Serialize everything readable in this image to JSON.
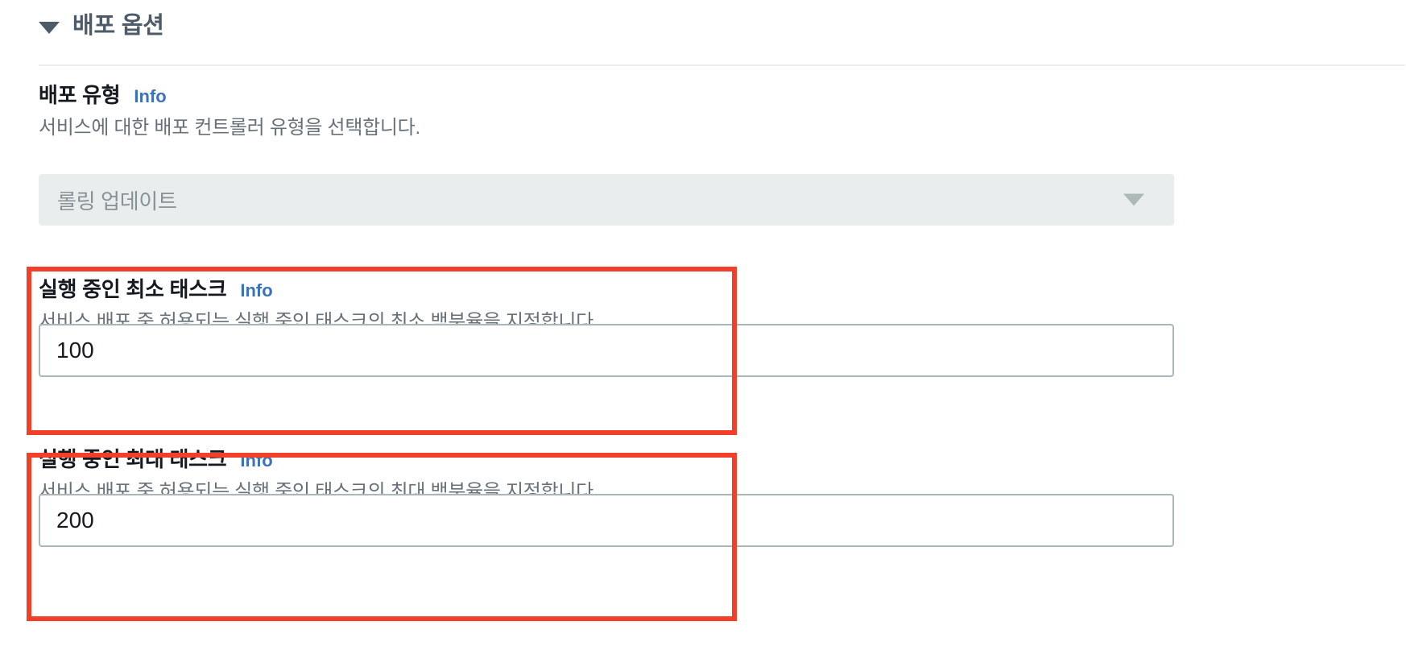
{
  "section": {
    "title": "배포 옵션",
    "caret_icon": "triangle-down-icon",
    "expanded": true
  },
  "fields": [
    {
      "key": "deployment_type",
      "label": "배포 유형",
      "info_label": "Info",
      "description": "서비스에 대한 배포 컨트롤러 유형을 선택합니다.",
      "control": "select",
      "value": "롤링 업데이트",
      "disabled": true,
      "caret_icon": "chevron-down-icon",
      "highlighted": false
    },
    {
      "key": "minimum_running_tasks",
      "label": "실행 중인 최소 태스크",
      "info_label": "Info",
      "description": "서비스 배포 중 허용되는 실행 중인 태스크의 최소 백분율을 지정합니다.",
      "control": "number",
      "value": "100",
      "placeholder": "",
      "disabled": false,
      "highlighted": true
    },
    {
      "key": "maximum_running_tasks",
      "label": "실행 중인 최대 태스크",
      "info_label": "Info",
      "description": "서비스 배포 중 허용되는 실행 중인 태스크의 최대 백분율을 지정합니다.",
      "control": "number",
      "value": "200",
      "placeholder": "",
      "disabled": false,
      "highlighted": true
    }
  ],
  "colors": {
    "highlight": "#f0402a",
    "info_link": "#3b73b9",
    "label": "#16191f",
    "description": "#687078",
    "section_title": "#4d5a68",
    "disabled_bg": "#eaedee",
    "disabled_text": "#879196",
    "input_border": "#aab7b8",
    "divider": "#eaeded"
  }
}
